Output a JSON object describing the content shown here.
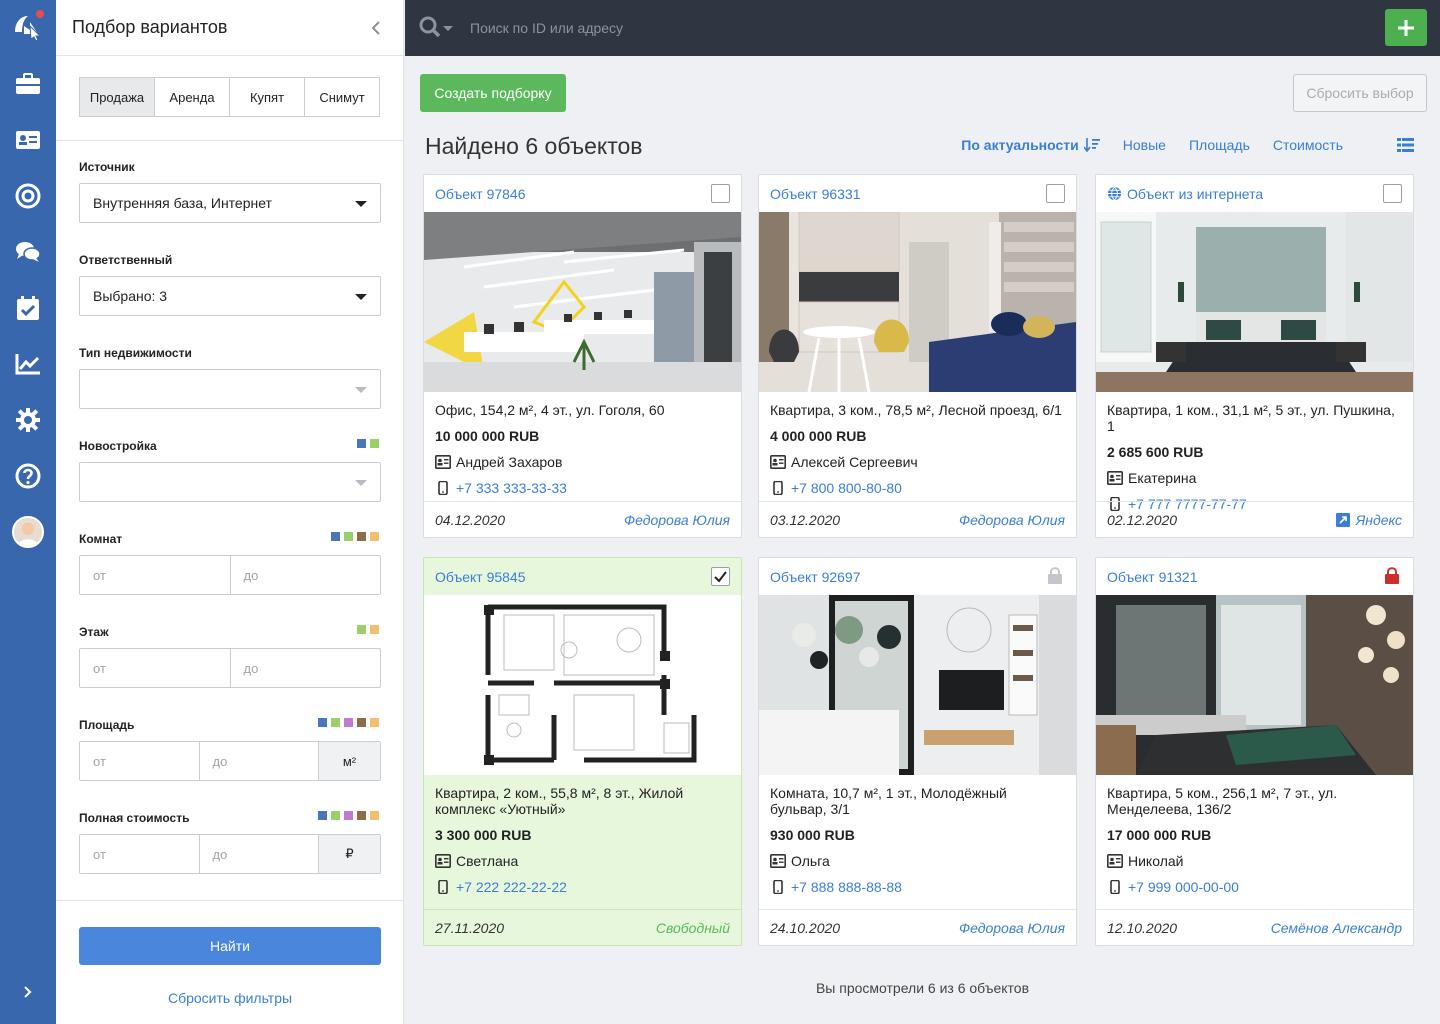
{
  "colors": {
    "rail": "#3867ad",
    "topbar": "#2f3641",
    "accent": "#4a86dc",
    "green": "#5cb85c",
    "link": "#3a7fd4",
    "selected_card": "#e7f7dc"
  },
  "panel": {
    "title": "Подбор вариантов",
    "deal_tabs": [
      "Продажа",
      "Аренда",
      "Купят",
      "Снимут"
    ],
    "active_tab": "Продажа",
    "source": {
      "label": "Источник",
      "value": "Внутренняя база, Интернет"
    },
    "responsible": {
      "label": "Ответственный",
      "value": "Выбрано: 3"
    },
    "property_type": {
      "label": "Тип недвижимости",
      "value": ""
    },
    "new_building": {
      "label": "Новостройка",
      "value": "",
      "dots": [
        "#4a76b8",
        "#9ccf6a"
      ]
    },
    "rooms": {
      "label": "Комнат",
      "from": "от",
      "to": "до",
      "dots": [
        "#4a76b8",
        "#9ccf6a",
        "#8b6b4a",
        "#f0c070"
      ]
    },
    "floor": {
      "label": "Этаж",
      "from": "от",
      "to": "до",
      "dots": [
        "#9ccf6a",
        "#f0c070"
      ]
    },
    "area": {
      "label": "Площадь",
      "from": "от",
      "to": "до",
      "unit": "м²",
      "dots": [
        "#4a76b8",
        "#9ccf6a",
        "#c07ad0",
        "#8b6b4a",
        "#f0c070"
      ]
    },
    "price": {
      "label": "Полная стоимость",
      "from": "от",
      "to": "до",
      "unit": "₽",
      "dots": [
        "#4a76b8",
        "#9ccf6a",
        "#c07ad0",
        "#8b6b4a",
        "#f0c070"
      ]
    },
    "find_label": "Найти",
    "reset_label": "Сбросить фильтры"
  },
  "topbar": {
    "search_placeholder": "Поиск по ID или адресу"
  },
  "main": {
    "create_label": "Создать подборку",
    "reset_selection_label": "Сбросить выбор",
    "found_title": "Найдено 6 объектов",
    "sort": [
      "По актуальности",
      "Новые",
      "Площадь",
      "Стоимость"
    ],
    "viewed_note": "Вы просмотрели 6 из 6 объектов"
  },
  "cards": [
    {
      "id": "Объект 97846",
      "title": "Офис, 154,2 м², 4 эт., ул. Гоголя, 60",
      "price": "10 000 000 RUB",
      "contact": "Андрей Захаров",
      "phone": "+7 333 333-33-33",
      "date": "04.12.2020",
      "agent": "Федорова Юлия",
      "image": "office-photo",
      "state": "checkbox"
    },
    {
      "id": "Объект 96331",
      "title": "Квартира, 3 ком., 78,5 м², Лесной проезд, 6/1",
      "price": "4 000 000 RUB",
      "contact": "Алексей Сергеевич",
      "phone": "+7 800 800-80-80",
      "date": "03.12.2020",
      "agent": "Федорова Юлия",
      "image": "kitchen-photo",
      "state": "checkbox"
    },
    {
      "id": "Объект из интернета",
      "title": "Квартира, 1 ком., 31,1 м², 5 эт.,  ул. Пушкина, 1",
      "price": "2 685 600 RUB",
      "contact": "Екатерина",
      "phone": "+7 777 7777-77-77",
      "date": "02.12.2020",
      "agent": "Яндекс",
      "image": "bedroom-photo",
      "state": "checkbox",
      "internet": true
    },
    {
      "id": "Объект 95845",
      "title": "Квартира, 2 ком., 55,8 м², 8 эт., Жилой комплекс «Уютный»",
      "price": "3 300 000 RUB",
      "contact": "Светлана",
      "phone": "+7 222 222-22-22",
      "date": "27.11.2020",
      "agent": "Свободный",
      "image": "floorplan",
      "state": "checked"
    },
    {
      "id": "Объект 92697",
      "title": "Комната, 10,7 м², 1 эт., Молодёжный бульвар, 3/1",
      "price": "930 000 RUB",
      "contact": "Ольга",
      "phone": "+7 888 888-88-88",
      "date": "24.10.2020",
      "agent": "Федорова Юлия",
      "image": "living-photo",
      "state": "lock-grey"
    },
    {
      "id": "Объект 91321",
      "title": "Квартира, 5 ком., 256,1 м², 7 эт., ул. Менделеева, 136/2",
      "price": "17 000 000 RUB",
      "contact": "Николай",
      "phone": "+7 999 000-00-00",
      "date": "12.10.2020",
      "agent": "Семёнов Александр",
      "image": "master-bedroom-photo",
      "state": "lock-red"
    }
  ]
}
